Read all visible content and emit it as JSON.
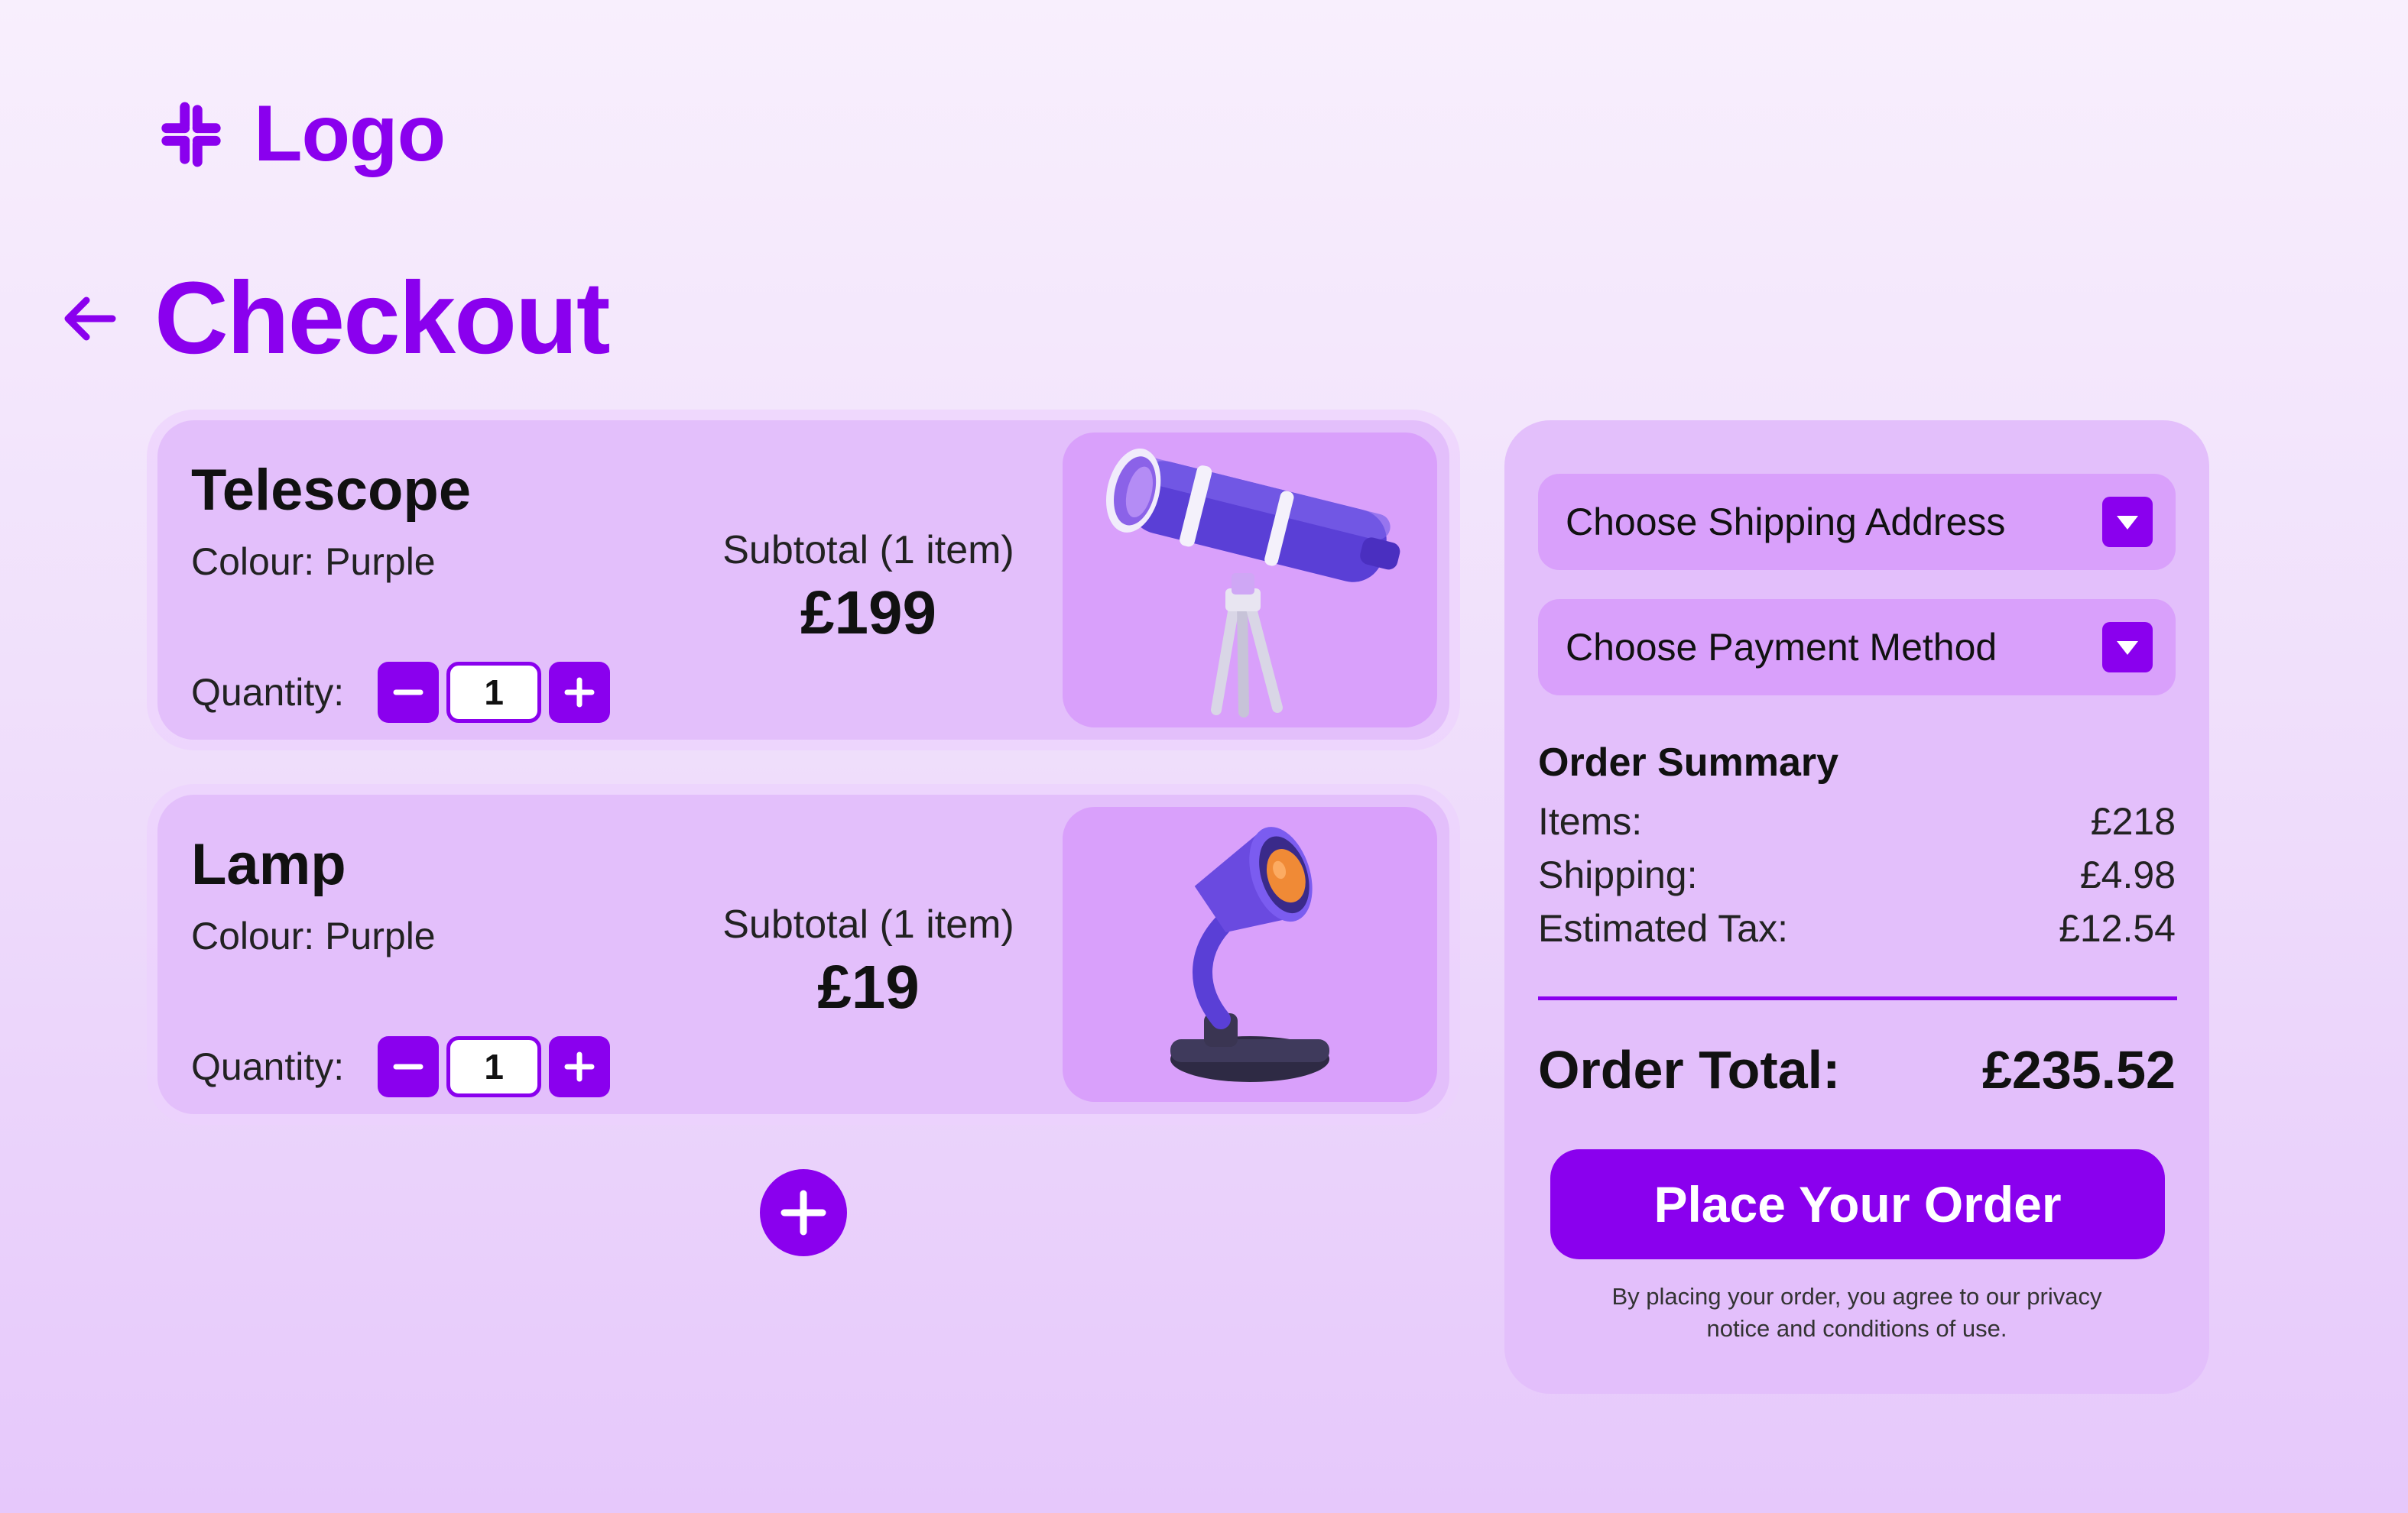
{
  "brand": {
    "logo_text": "Logo",
    "logo_icon": "slack-like-hash-icon",
    "accent": "#8a00ee"
  },
  "header": {
    "title": "Checkout",
    "back_icon": "arrow-left-icon"
  },
  "cart": {
    "items": [
      {
        "name": "Telescope",
        "colour": "Colour: Purple",
        "quantity_label": "Quantity:",
        "quantity": "1",
        "subtotal_label": "Subtotal (1 item)",
        "subtotal": "£199",
        "image_icon": "telescope-icon"
      },
      {
        "name": "Lamp",
        "colour": "Colour: Purple",
        "quantity_label": "Quantity:",
        "quantity": "1",
        "subtotal_label": "Subtotal (1 item)",
        "subtotal": "£19",
        "image_icon": "desk-lamp-icon"
      }
    ],
    "add_item_icon": "plus-icon"
  },
  "summary": {
    "shipping_dropdown": "Choose Shipping Address",
    "payment_dropdown": "Choose Payment Method",
    "heading": "Order Summary",
    "rows": [
      {
        "label": "Items:",
        "value": "£218"
      },
      {
        "label": "Shipping:",
        "value": "£4.98"
      },
      {
        "label": "Estimated Tax:",
        "value": "£12.54"
      }
    ],
    "total_label": "Order Total:",
    "total_value": "£235.52",
    "place_order": "Place Your Order",
    "legal": "By placing your order, you agree to our privacy notice and conditions of use."
  }
}
